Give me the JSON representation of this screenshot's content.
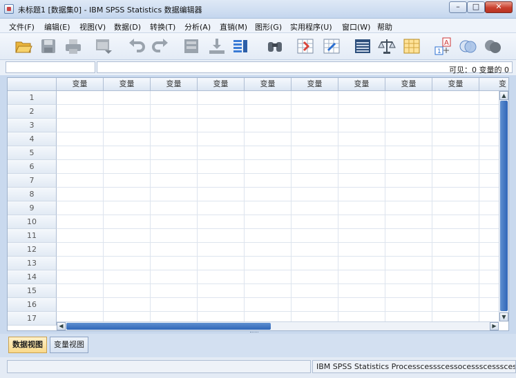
{
  "window": {
    "title": "未标题1 [数据集0] - IBM SPSS Statistics 数据编辑器",
    "minimize_label": "–",
    "maximize_label": "□",
    "close_label": "✕"
  },
  "menu": {
    "items": [
      "文件(F)",
      "编辑(E)",
      "视图(V)",
      "数据(D)",
      "转换(T)",
      "分析(A)",
      "直销(M)",
      "图形(G)",
      "实用程序(U)",
      "窗口(W)",
      "帮助"
    ]
  },
  "toolbar": {
    "icons": [
      "open-icon",
      "save-icon",
      "print-icon",
      "dialog-recall-icon",
      "undo-icon",
      "redo-icon",
      "goto-case-icon",
      "goto-variable-icon",
      "variables-icon",
      "find-icon",
      "insert-cases-icon",
      "insert-variable-icon",
      "split-file-icon",
      "weight-cases-icon",
      "select-cases-icon",
      "value-labels-icon",
      "use-sets-icon",
      "show-all-icon"
    ]
  },
  "editor": {
    "visible_status": "可见：0 变量的 0"
  },
  "grid": {
    "column_headers": [
      "变量",
      "变量",
      "变量",
      "变量",
      "变量",
      "变量",
      "变量",
      "变量",
      "变量",
      "变"
    ],
    "row_numbers": [
      "1",
      "2",
      "3",
      "4",
      "5",
      "6",
      "7",
      "8",
      "9",
      "10",
      "11",
      "12",
      "13",
      "14",
      "15",
      "16",
      "17"
    ]
  },
  "tabs": {
    "data_view": "数据视图",
    "variable_view": "变量视图"
  },
  "status": {
    "processor": "IBM SPSS Statistics Processcessscessocessscessscessscessscessscessscess"
  },
  "colors": {
    "accent": "#2f66b8",
    "active_tab": "#f9d98a"
  }
}
